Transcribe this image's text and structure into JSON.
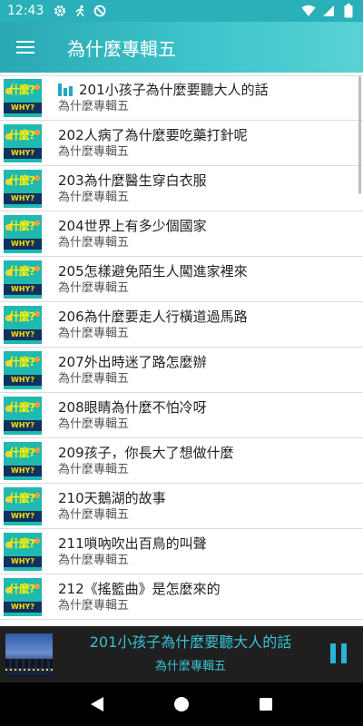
{
  "status": {
    "time": "12:43"
  },
  "appbar": {
    "title": "為什麼專輯五"
  },
  "list": {
    "items": [
      {
        "title": "201小孩子為什麼要聽大人的話",
        "subtitle": "為什麼專輯五",
        "playing": true
      },
      {
        "title": "202人病了為什麼要吃藥打針呢",
        "subtitle": "為什麼專輯五"
      },
      {
        "title": "203為什麼醫生穿白衣服",
        "subtitle": "為什麼專輯五"
      },
      {
        "title": "204世界上有多少個國家",
        "subtitle": "為什麼專輯五"
      },
      {
        "title": "205怎樣避免陌生人闖進家裡來",
        "subtitle": "為什麼專輯五"
      },
      {
        "title": "206為什麼要走人行橫道過馬路",
        "subtitle": "為什麼專輯五"
      },
      {
        "title": "207外出時迷了路怎麼辦",
        "subtitle": "為什麼專輯五"
      },
      {
        "title": "208眼睛為什麼不怕冷呀",
        "subtitle": "為什麼專輯五"
      },
      {
        "title": "209孩子，你長大了想做什麼",
        "subtitle": "為什麼專輯五"
      },
      {
        "title": "210天鵝湖的故事",
        "subtitle": "為什麼專輯五"
      },
      {
        "title": "211嗩吶吹出百鳥的叫聲",
        "subtitle": "為什麼專輯五"
      },
      {
        "title": "212《搖籃曲》是怎麼來的",
        "subtitle": "為什麼專輯五"
      }
    ],
    "thumb": {
      "q_text": "什麼?",
      "why_text": "WHY?"
    }
  },
  "player": {
    "title": "201小孩子為什麼要聽大人的話",
    "subtitle": "為什麼專輯五"
  },
  "colors": {
    "accent": "#2ab0b8",
    "player_text": "#39c3d3",
    "player_bg": "#1f1f1f"
  },
  "icons": {
    "status_left": [
      "gear-icon",
      "running-icon",
      "blocked-icon"
    ],
    "status_right": [
      "wifi-icon",
      "signal-icon",
      "battery-icon"
    ],
    "appbar": "menu-icon",
    "nav": [
      "back-icon",
      "home-icon",
      "recents-icon"
    ]
  }
}
